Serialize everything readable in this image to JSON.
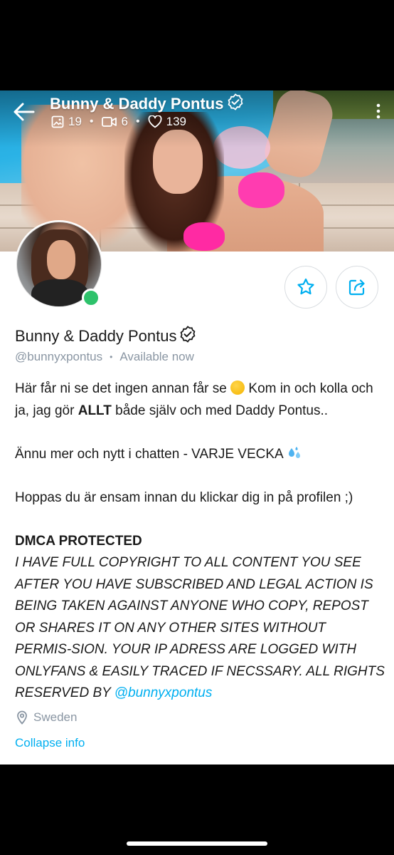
{
  "header": {
    "title": "Bunny & Daddy Pontus",
    "verified_icon": "verified-badge-icon",
    "stats": {
      "photos": "19",
      "videos": "6",
      "likes": "139"
    }
  },
  "profile": {
    "name": "Bunny & Daddy Pontus",
    "handle": "@bunnyxpontus",
    "separator": "•",
    "status": "Available now",
    "online": true
  },
  "bio": {
    "line1_a": "Här får ni se det ingen annan får se ",
    "line1_b": " Kom in och kolla och ja, jag gör ",
    "line1_bold": "ALLT",
    "line1_c": " både själv och med Daddy Pontus..",
    "line2_a": "Ännu mer och nytt i chatten - VARJE VECKA ",
    "line3": "Hoppas du är ensam innan du klickar dig in på profilen ;)",
    "dmca_title": "DMCA PROTECTED",
    "dmca_text": "I HAVE FULL COPYRIGHT TO ALL CONTENT YOU SEE AFTER YOU HAVE SUBSCRIBED AND LEGAL ACTION IS BEING TAKEN AGAINST ANYONE WHO COPY, REPOST OR SHARES IT ON ANY OTHER SITES WITHOUT PERMIS-SION. YOUR IP ADRESS ARE LOGGED WITH ONLYFANS & EASILY TRACED IF NECSSARY. ALL RIGHTS RESERVED BY ",
    "dmca_link": "@bunnyxpontus"
  },
  "location": "Sweden",
  "collapse_label": "Collapse info",
  "colors": {
    "accent": "#00aff0",
    "online": "#2ec26b",
    "muted": "#8a96a3"
  }
}
